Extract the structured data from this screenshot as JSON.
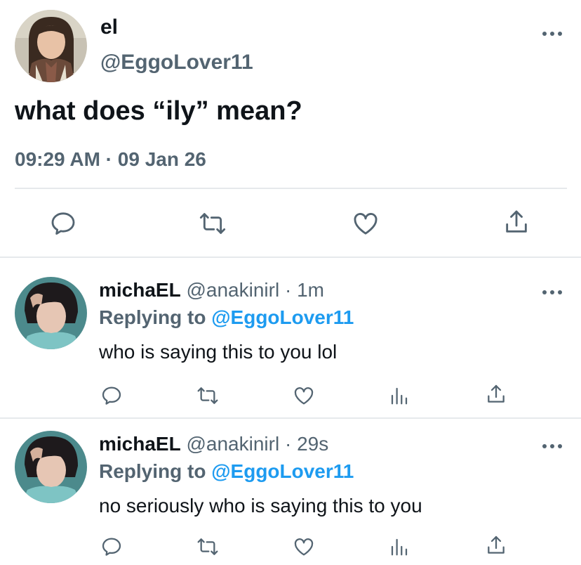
{
  "main_tweet": {
    "display_name": "el",
    "handle": "@EggoLover11",
    "text": "what does “ily” mean?",
    "meta": "09:29 AM · 09 Jan 26",
    "avatar_icon": "profile-photo-woman",
    "actions": [
      "reply-icon",
      "retweet-icon",
      "like-icon",
      "share-icon"
    ]
  },
  "replies": [
    {
      "display_name": "michaEL",
      "meta": "@anakinirl · 1m",
      "replying_prefix": "Replying to",
      "replying_to": "@EggoLover11",
      "text": "who is saying this to you lol",
      "avatar_icon": "profile-photo-boy",
      "actions": [
        "reply-icon",
        "retweet-icon",
        "like-icon",
        "analytics-icon",
        "share-icon"
      ]
    },
    {
      "display_name": "michaEL",
      "meta": "@anakinirl · 29s",
      "replying_prefix": "Replying to",
      "replying_to": "@EggoLover11",
      "text": "no seriously who is saying this to you",
      "avatar_icon": "profile-photo-boy",
      "actions": [
        "reply-icon",
        "retweet-icon",
        "like-icon",
        "analytics-icon",
        "share-icon"
      ]
    }
  ],
  "colors": {
    "text": "#0f1419",
    "secondary": "#536471",
    "accent": "#1d9bf0",
    "divider": "#e6e9ec"
  }
}
